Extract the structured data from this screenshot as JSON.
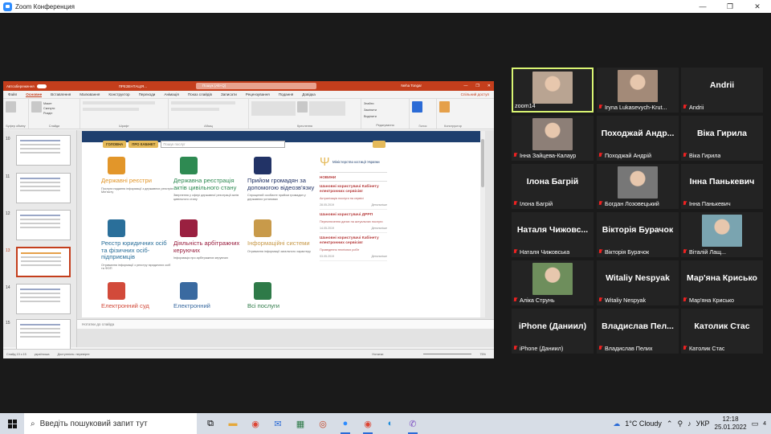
{
  "window": {
    "title": "Zoom Конференция",
    "controls": [
      "—",
      "❐",
      "✕"
    ]
  },
  "powerpoint": {
    "autosave_label": "Автозбереження",
    "file_name": "ПРЕЗЕНТАЦІЯ...",
    "search_placeholder": "Пошук (Alt+Q)",
    "user_name": "Neha Tongar",
    "tabs": [
      "Файл",
      "Основне",
      "Вставлення",
      "Малювання",
      "Конструктор",
      "Переходи",
      "Анімація",
      "Показ слайдів",
      "Записати",
      "Рецензування",
      "Подання",
      "Довідка"
    ],
    "active_tab": "Основне",
    "share_label": "Спільний доступ",
    "ribbon_groups": [
      "Буфер обміну",
      "Слайди",
      "Шрифт",
      "Абзац",
      "Креслення",
      "Редагування",
      "Голос",
      "Конструктор"
    ],
    "ribbon_buttons": {
      "paste": "Вставити",
      "new_slide": "Створити слайд",
      "layout": "Макет",
      "reset": "Скинути",
      "section": "Розділ",
      "arrange": "Упорядкувати",
      "find": "Знайти",
      "replace": "Замінити",
      "select": "Виділити",
      "dictate": "Надиктувати",
      "designer": "Варіанти оформлення"
    },
    "thumb_numbers": [
      "10",
      "11",
      "12",
      "13",
      "14",
      "15"
    ],
    "selected_thumb": "13",
    "notes_placeholder": "Нотатки до слайда",
    "status": {
      "slide_counter": "Слайд 13 з 15",
      "language": "українська",
      "accessibility": "Доступність: перевірте",
      "notes": "Нотатки",
      "zoom_pct": "75%"
    }
  },
  "slide": {
    "nav_buttons": [
      "ГОЛОВНА",
      "ПРО КАБІНЕТ"
    ],
    "search_placeholder": "Пошук послуг",
    "tiles": [
      {
        "title": "Державні реєстри",
        "desc": "Послуги надання інформації з державних реєстрів Мін'юсту",
        "color": "#e2962a"
      },
      {
        "title": "Державна реєстрація актів цивільного стану",
        "desc": "Звернення у сфері державної реєстрації актів цивільного стану",
        "color": "#2e8a52"
      },
      {
        "title": "Прийом громадян за допомогою відеозв'язку",
        "desc": "Спрощений особисте прийом громадян у державних установах",
        "color": "#223366"
      },
      {
        "title": "Реєстр юридичних осіб та фізичних осіб-підприємців",
        "desc": "Отримання інформації з реєстру юридичних осіб та ФОП",
        "color": "#2a6f9a"
      },
      {
        "title": "Діяльність арбітражних керуючих",
        "desc": "Інформація про арбітражних керуючих",
        "color": "#9a2040"
      },
      {
        "title": "Інформаційні системи",
        "desc": "Отримання інформації загального характеру",
        "color": "#c89a4a"
      },
      {
        "title": "Електронний суд",
        "desc": "",
        "color": "#d24a3a"
      },
      {
        "title": "Електронний",
        "desc": "",
        "color": "#3a6aa0"
      },
      {
        "title": "Всі послуги",
        "desc": "",
        "color": "#2e7a48"
      }
    ],
    "ministry": "Міністерство юстиції України",
    "news_heading": "НОВИНИ",
    "news": [
      {
        "title": "Шановні користувачі Кабінету електронних сервісів!",
        "desc": "Актуалізація послуги на сервісі",
        "date": "28.05.2019",
        "more": "Детальніше"
      },
      {
        "title": "Шановні користувачі ДРРП",
        "desc": "Переключення даних на актуальних послуги",
        "date": "14.05.2019",
        "more": "Детальніше"
      },
      {
        "title": "Шановні користувачі Кабінету електронних сервісів!",
        "desc": "Проведення технічних робіт",
        "date": "03.05.2019",
        "more": "Детальніше"
      }
    ]
  },
  "participants": [
    {
      "name": "zoom14",
      "label": "zoom14",
      "video": true,
      "active": true,
      "muted": false,
      "photo_color": "#b9a492"
    },
    {
      "name": "Iryna Lukasevych-Krut...",
      "label": "Iryna Lukasevych-Krut...",
      "video": true,
      "active": false,
      "muted": true,
      "photo_color": "#a38a78"
    },
    {
      "name": "Andrii",
      "label": "Andrii",
      "video": false,
      "active": false,
      "muted": true
    },
    {
      "name": "Інна Зайцева-Калаур",
      "label": "Інна Зайцева-Калаур",
      "video": true,
      "active": false,
      "muted": true,
      "photo_color": "#8d7f77"
    },
    {
      "name": "Походжай Андр...",
      "label": "Походжай Андрій",
      "video": false,
      "active": false,
      "muted": true
    },
    {
      "name": "Віка Гирила",
      "label": "Віка Гирила",
      "video": false,
      "active": false,
      "muted": true
    },
    {
      "name": "Ілона Багрій",
      "label": "Ілона Багрій",
      "video": false,
      "active": false,
      "muted": true
    },
    {
      "name": "Богдан Лозовецький",
      "label": "Богдан Лозовецький",
      "video": true,
      "active": false,
      "muted": true,
      "photo_color": "#777777"
    },
    {
      "name": "Інна Панькевич",
      "label": "Інна Панькевич",
      "video": false,
      "active": false,
      "muted": true
    },
    {
      "name": "Наталя  Чижовс...",
      "label": "Наталя Чижовська",
      "video": false,
      "active": false,
      "muted": true
    },
    {
      "name": "Вікторія Бурачок",
      "label": "Вікторія Бурачок",
      "video": false,
      "active": false,
      "muted": true
    },
    {
      "name": "Віталій Лащ...",
      "label": "Віталій Лащ...",
      "video": true,
      "active": false,
      "muted": true,
      "photo_color": "#7aa4b0"
    },
    {
      "name": "Аліка Струнь",
      "label": "Аліка Струнь",
      "video": true,
      "active": false,
      "muted": true,
      "photo_color": "#6e8e5c"
    },
    {
      "name": "Witaliy Nespyak",
      "label": "Witaliy Nespyak",
      "video": false,
      "active": false,
      "muted": true
    },
    {
      "name": "Мар'яна Крисько",
      "label": "Мар'яна Крисько",
      "video": false,
      "active": false,
      "muted": true
    },
    {
      "name": "iPhone (Даниил)",
      "label": "iPhone (Даниил)",
      "video": false,
      "active": false,
      "muted": true
    },
    {
      "name": "Владислав  Пел...",
      "label": "Владислав Пелих",
      "video": false,
      "active": false,
      "muted": true
    },
    {
      "name": "Католик Стас",
      "label": "Католик Стас",
      "video": false,
      "active": false,
      "muted": true
    }
  ],
  "taskbar": {
    "search_placeholder": "Введіть пошуковий запит тут",
    "weather": "1°C  Cloudy",
    "language": "УКР",
    "time": "12:18",
    "date": "25.01.2022",
    "notifications": "4"
  },
  "colors": {
    "ppt_accent": "#c43e1c",
    "zoom_accent": "#2d8cff",
    "active_speaker": "#d9f573",
    "muted_mic": "#e22222"
  }
}
